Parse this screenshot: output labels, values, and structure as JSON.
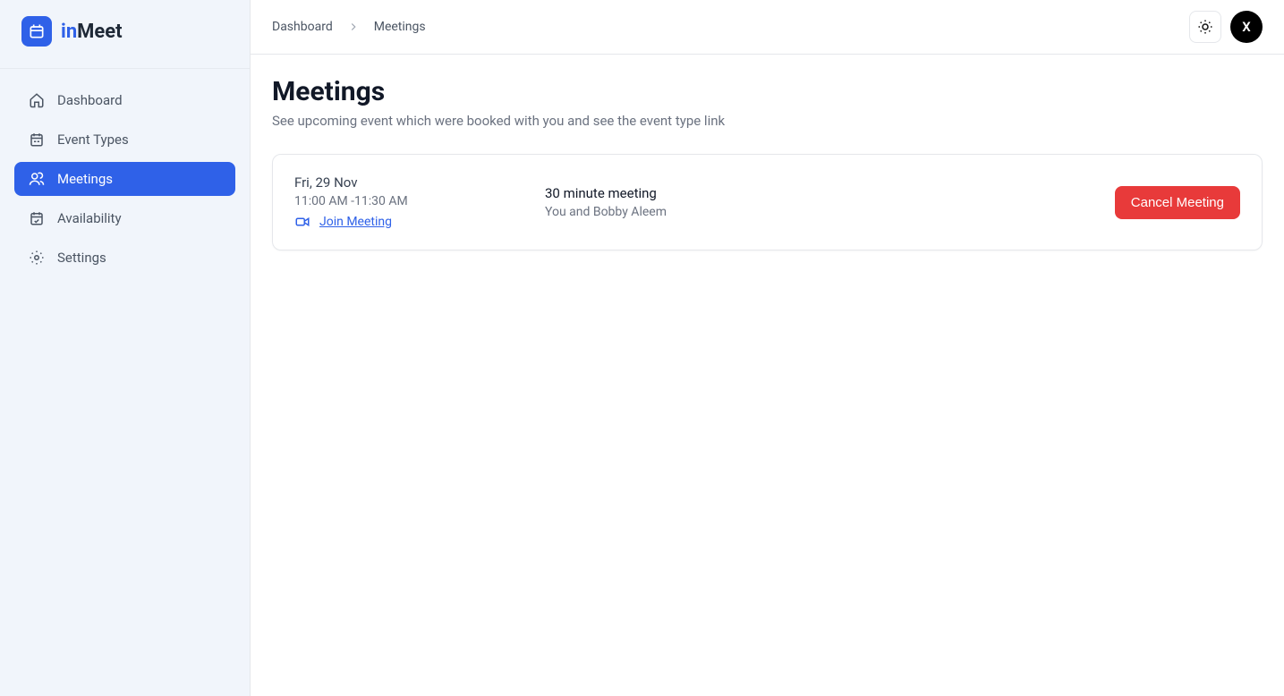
{
  "logo": {
    "prefix": "in",
    "suffix": "Meet"
  },
  "sidebar": {
    "items": [
      {
        "label": "Dashboard",
        "icon": "home"
      },
      {
        "label": "Event Types",
        "icon": "calendar-range"
      },
      {
        "label": "Meetings",
        "icon": "users"
      },
      {
        "label": "Availability",
        "icon": "calendar-check"
      },
      {
        "label": "Settings",
        "icon": "cog"
      }
    ],
    "activeIndex": 2
  },
  "breadcrumb": {
    "items": [
      {
        "label": "Dashboard"
      },
      {
        "label": "Meetings"
      }
    ]
  },
  "avatar": {
    "initial": "X"
  },
  "page": {
    "title": "Meetings",
    "subtitle": "See upcoming event which were booked with you and see the event type link"
  },
  "meetings": [
    {
      "date": "Fri, 29 Nov",
      "time": "11:00 AM -11:30 AM",
      "join_label": "Join Meeting",
      "title": "30 minute meeting",
      "participants": "You and Bobby Aleem",
      "cancel_label": "Cancel Meeting"
    }
  ]
}
